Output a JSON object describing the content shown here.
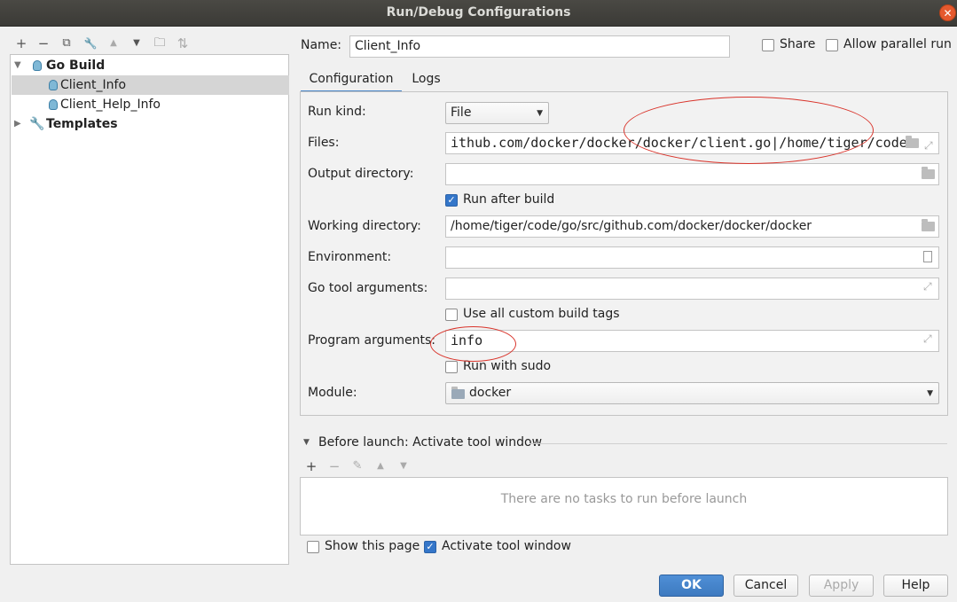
{
  "window": {
    "title": "Run/Debug Configurations",
    "close_glyph": "✕"
  },
  "toolbar": {
    "icons": [
      {
        "name": "add-icon",
        "glyph": "+"
      },
      {
        "name": "remove-icon",
        "glyph": "−"
      },
      {
        "name": "copy-icon",
        "glyph": "⧉"
      },
      {
        "name": "wrench-icon",
        "glyph": "🔧"
      },
      {
        "name": "move-up-icon",
        "glyph": "▲"
      },
      {
        "name": "move-down-icon",
        "glyph": "▼"
      },
      {
        "name": "new-folder-icon",
        "glyph": "🗀"
      },
      {
        "name": "sort-icon",
        "glyph": "⇅"
      }
    ]
  },
  "tree": {
    "go_build": "Go Build",
    "items": [
      "Client_Info",
      "Client_Help_Info"
    ],
    "templates": "Templates"
  },
  "header": {
    "name_label": "Name:",
    "name_value": "Client_Info",
    "share_label": "Share",
    "parallel_label": "Allow parallel run"
  },
  "tabs": {
    "configuration": "Configuration",
    "logs": "Logs"
  },
  "form": {
    "run_kind_label": "Run kind:",
    "run_kind_value": "File",
    "files_label": "Files:",
    "files_value": "ithub.com/docker/docker/docker/client.go|/home/tiger/code",
    "output_label": "Output directory:",
    "output_value": "",
    "run_after_build": "Run after build",
    "working_label": "Working directory:",
    "working_value": "/home/tiger/code/go/src/github.com/docker/docker/docker",
    "environment_label": "Environment:",
    "environment_value": "",
    "go_tool_label": "Go tool arguments:",
    "go_tool_value": "",
    "custom_tags": "Use all custom build tags",
    "program_args_label": "Program arguments:",
    "program_args_value": "info",
    "run_sudo": "Run with sudo",
    "module_label": "Module:",
    "module_value": "docker"
  },
  "before_launch": {
    "title": "Before launch: Activate tool window",
    "empty_text": "There are no tasks to run before launch"
  },
  "footer": {
    "show_page": "Show this page",
    "activate_tool": "Activate tool window",
    "ok": "OK",
    "cancel": "Cancel",
    "apply": "Apply",
    "help": "Help"
  },
  "colors": {
    "accent": "#3476c9",
    "annotation": "#d9342b",
    "titlebar": "#3b3a36"
  }
}
